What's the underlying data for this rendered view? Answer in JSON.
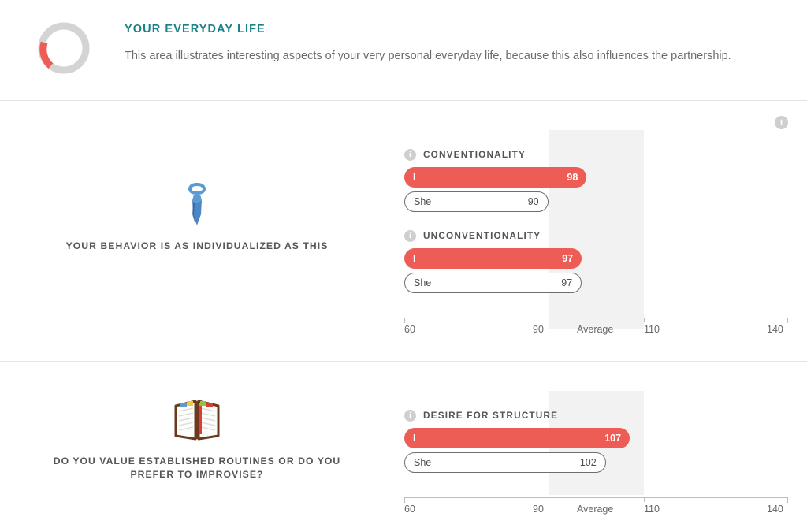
{
  "header": {
    "icon_name": "donut-progress-icon",
    "title": "YOUR EVERYDAY LIFE",
    "description": "This area illustrates interesting aspects of your very personal everyday life, because this also influences the partnership.",
    "title_color": "#1b8189",
    "donut_track_color": "#d4d4d4",
    "donut_value_color": "#ee5d55"
  },
  "info_icon": {
    "glyph": "i",
    "name": "section-info-icon"
  },
  "axis": {
    "min": 60,
    "max": 140,
    "ticks": [
      {
        "value": 60,
        "label": "60"
      },
      {
        "value": 90,
        "label": "90"
      },
      {
        "value": 110,
        "label": "110"
      },
      {
        "value": 140,
        "label": "140"
      }
    ],
    "average_band": {
      "from": 90,
      "to": 110,
      "label": "Average",
      "color": "#f2f2f2"
    }
  },
  "colors": {
    "bar_self": "#ee5d55",
    "bar_partner_border": "#6e6e6e",
    "divider": "#e3e3e3",
    "label_text": "#555555"
  },
  "sections": [
    {
      "emoji": "👔",
      "emoji_name": "necktie-icon",
      "caption": "YOUR BEHAVIOR IS AS INDIVIDUALIZED AS THIS",
      "metrics": [
        {
          "label": "CONVENTIONALITY",
          "self": {
            "name": "I",
            "value": 98
          },
          "partner": {
            "name": "She",
            "value": 90
          }
        },
        {
          "label": "UNCONVENTIONALITY",
          "self": {
            "name": "I",
            "value": 97
          },
          "partner": {
            "name": "She",
            "value": 97
          }
        }
      ]
    },
    {
      "emoji": "📖",
      "emoji_name": "open-notebook-icon",
      "caption": "DO YOU VALUE ESTABLISHED ROUTINES OR DO YOU PREFER TO IMPROVISE?",
      "metrics": [
        {
          "label": "DESIRE FOR STRUCTURE",
          "self": {
            "name": "I",
            "value": 107
          },
          "partner": {
            "name": "She",
            "value": 102
          }
        }
      ]
    }
  ],
  "chart_data": {
    "type": "bar",
    "title": "YOUR EVERYDAY LIFE",
    "xlabel": "",
    "ylabel": "",
    "xlim": [
      60,
      140
    ],
    "grid": false,
    "orientation": "horizontal",
    "tick_labels": [
      "60",
      "90",
      "110",
      "140"
    ],
    "annotations": [
      "Average"
    ],
    "categories": [
      "CONVENTIONALITY",
      "UNCONVENTIONALITY",
      "DESIRE FOR STRUCTURE"
    ],
    "series": [
      {
        "name": "I",
        "values": [
          98,
          97,
          107
        ],
        "color": "#ee5d55"
      },
      {
        "name": "She",
        "values": [
          90,
          97,
          102
        ],
        "color": "#ffffff"
      }
    ]
  }
}
